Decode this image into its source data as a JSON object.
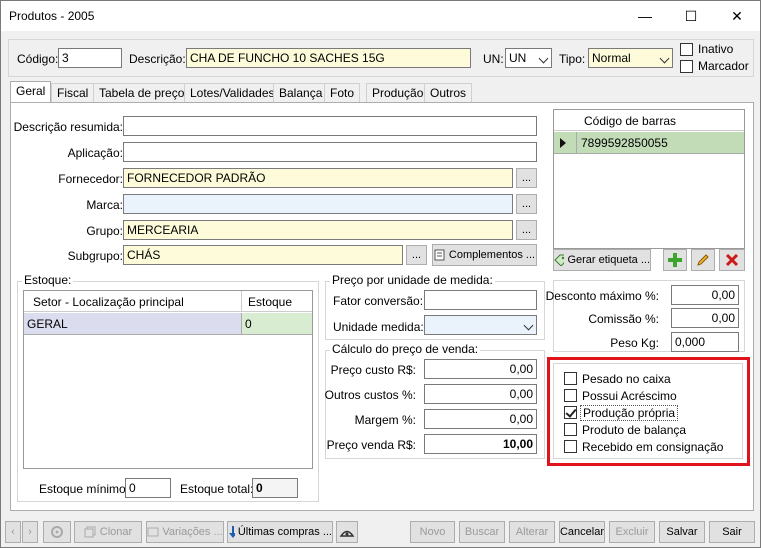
{
  "window": {
    "title": "Produtos - 2005",
    "minimize": "—",
    "maximize": "☐",
    "close": "✕"
  },
  "header": {
    "codigo_label": "Código:",
    "codigo_value": "3",
    "descricao_label": "Descrição:",
    "descricao_value": "CHA DE FUNCHO 10 SACHES 15G",
    "un_label": "UN:",
    "un_value": "UN",
    "tipo_label": "Tipo:",
    "tipo_value": "Normal",
    "inativo_label": "Inativo",
    "marcador_label": "Marcador"
  },
  "tabs": [
    "Geral",
    "Fiscal",
    "Tabela de preço",
    "Lotes/Validades",
    "Balança",
    "Foto",
    "Produção",
    "Outros"
  ],
  "geral": {
    "descricao_resumida_label": "Descrição resumida:",
    "descricao_resumida_value": "",
    "aplicacao_label": "Aplicação:",
    "aplicacao_value": "",
    "fornecedor_label": "Fornecedor:",
    "fornecedor_value": "FORNECEDOR PADRÃO",
    "marca_label": "Marca:",
    "marca_value": "",
    "grupo_label": "Grupo:",
    "grupo_value": "MERCEARIA",
    "subgrupo_label": "Subgrupo:",
    "subgrupo_value": "CHÁS",
    "browse_label": "...",
    "complementos_label": "Complementos ..."
  },
  "barcodes": {
    "header": "Código de barras",
    "rows": [
      "7899592850055"
    ],
    "gerar_etiqueta_label": "Gerar etiqueta ..."
  },
  "estoque": {
    "title": "Estoque:",
    "col_setor": "Setor - Localização principal",
    "col_estoque": "Estoque",
    "rows": [
      {
        "setor": "GERAL",
        "estoque": "0"
      }
    ],
    "minimo_label": "Estoque mínimo:",
    "minimo_value": "0",
    "total_label": "Estoque total:",
    "total_value": "0"
  },
  "preco_unidade": {
    "title": "Preço por unidade de medida:",
    "fator_label": "Fator conversão:",
    "fator_value": "",
    "unidade_label": "Unidade medida:",
    "unidade_value": ""
  },
  "calculo": {
    "title": "Cálculo do preço de venda:",
    "custo_label": "Preço custo R$:",
    "custo_value": "0,00",
    "outros_label": "Outros custos %:",
    "outros_value": "0,00",
    "margem_label": "Margem %:",
    "margem_value": "0,00",
    "venda_label": "Preço venda R$:",
    "venda_value": "10,00"
  },
  "descontos": {
    "desconto_label": "Desconto máximo %:",
    "desconto_value": "0,00",
    "comissao_label": "Comissão %:",
    "comissao_value": "0,00",
    "peso_label": "Peso Kg:",
    "peso_value": "0,000"
  },
  "flags": [
    {
      "label": "Pesado no caixa",
      "checked": false
    },
    {
      "label": "Possui Acréscimo",
      "checked": false
    },
    {
      "label": "Produção própria",
      "checked": true
    },
    {
      "label": "Produto de balança",
      "checked": false
    },
    {
      "label": "Recebido em consignação",
      "checked": false
    }
  ],
  "highlight_color": "#e0131b",
  "footer": {
    "clonar": "Clonar",
    "variacoes": "Variações ...",
    "ultimas_compras": "Últimas compras ...",
    "novo": "Novo",
    "buscar": "Buscar",
    "alterar": "Alterar",
    "cancelar": "Cancelar",
    "excluir": "Excluir",
    "salvar": "Salvar",
    "sair": "Sair"
  }
}
